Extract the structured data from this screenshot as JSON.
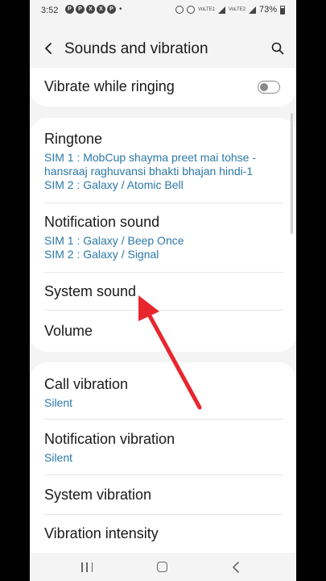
{
  "status_bar": {
    "time": "3:52",
    "app_icons": [
      "P",
      "P",
      "X",
      "X",
      "P"
    ],
    "battery": "73%",
    "sim1_label": "VoLTE1",
    "sim2_label": "VoLTE2"
  },
  "header": {
    "title": "Sounds and vibration",
    "back_icon": "chevron-left-icon",
    "search_icon": "search-icon"
  },
  "vibrate_while_ringing": {
    "label": "Vibrate while ringing",
    "enabled": false
  },
  "sounds": {
    "ringtone": {
      "label": "Ringtone",
      "sim1_line1": "SIM 1 : MobCup shayma preet mai tohse -",
      "sim1_line2": "hansraaj raghuvansi bhakti bhajan hindi-1",
      "sim2": "SIM 2 : Galaxy / Atomic Bell"
    },
    "notification_sound": {
      "label": "Notification sound",
      "sim1": "SIM 1 : Galaxy / Beep Once",
      "sim2": "SIM 2 : Galaxy / Signal"
    },
    "system_sound": {
      "label": "System sound"
    },
    "volume": {
      "label": "Volume"
    }
  },
  "vibrations": {
    "call_vibration": {
      "label": "Call vibration",
      "value": "Silent"
    },
    "notification_vibration": {
      "label": "Notification vibration",
      "value": "Silent"
    },
    "system_vibration": {
      "label": "System vibration"
    },
    "vibration_intensity": {
      "label": "Vibration intensity"
    }
  },
  "colors": {
    "accent_subtext": "#2c78a8",
    "annotation_arrow": "#e8262d",
    "background": "#f4f4f4",
    "card": "#ffffff"
  }
}
